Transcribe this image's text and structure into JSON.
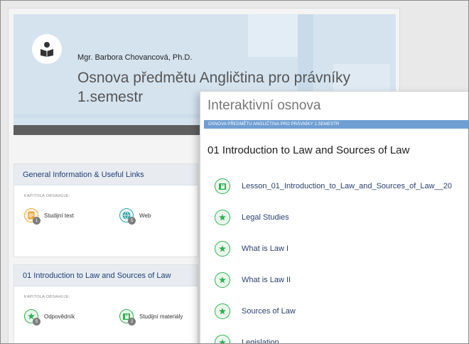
{
  "header": {
    "author": "Mgr. Barbora Chovancová, Ph.D.",
    "course_title": "Osnova předmětu Angličtina pro právníky 1.semestr"
  },
  "cards": [
    {
      "title": "General Information & Useful Links",
      "kapitola_label": "KAPITOLA OBSAHUJE:",
      "chips": [
        {
          "label": "Studijní text",
          "count": "1",
          "icon": "document-icon",
          "color": "#f0a53a"
        },
        {
          "label": "Web",
          "count": "5",
          "icon": "globe-icon",
          "color": "#34a3a3"
        }
      ]
    },
    {
      "title": "01 Introduction to Law and Sources of Law",
      "kapitola_label": "KAPITOLA OBSAHUJE:",
      "chips": [
        {
          "label": "Odpovědník",
          "count": "5",
          "icon": "puzzle-icon",
          "color": "#2fb24f"
        },
        {
          "label": "Studijní materiály",
          "count": "2",
          "icon": "folder-icon",
          "color": "#2fb24f"
        }
      ]
    }
  ],
  "panel": {
    "title": "Interaktivní osnova",
    "breadcrumb": "OSNOVA PŘEDMĚTU ANGLIČTINA PRO PRÁVNÍKY 1.SEMESTR",
    "section_title": "01 Introduction to Law and Sources of Law",
    "items": [
      {
        "label": "Lesson_01_Introduction_to_Law_and_Sources_of_Law__20",
        "icon": "folder-icon"
      },
      {
        "label": "Legal Studies",
        "icon": "puzzle-icon"
      },
      {
        "label": "What is Law I",
        "icon": "puzzle-icon"
      },
      {
        "label": "What is Law II",
        "icon": "puzzle-icon"
      },
      {
        "label": "Sources of Law",
        "icon": "puzzle-icon"
      },
      {
        "label": "Legislation",
        "icon": "puzzle-icon"
      }
    ]
  },
  "colors": {
    "accent_blue": "#6f9ed3",
    "link_navy": "#2a3f6e",
    "green": "#2fb24f"
  }
}
